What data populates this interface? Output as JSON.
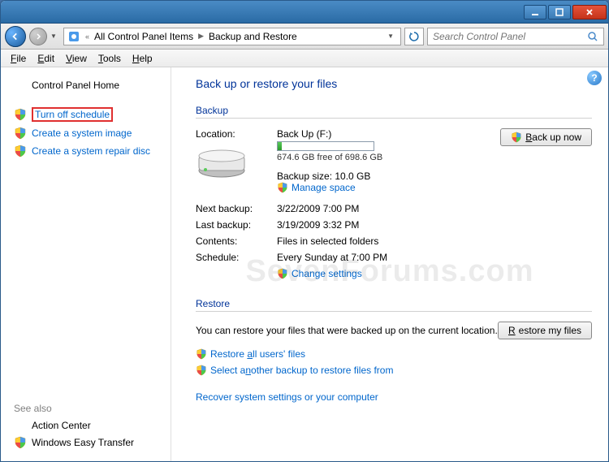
{
  "breadcrumb": {
    "prev": "All Control Panel Items",
    "current": "Backup and Restore"
  },
  "search": {
    "placeholder": "Search Control Panel"
  },
  "menu": {
    "file": "File",
    "edit": "Edit",
    "view": "View",
    "tools": "Tools",
    "help": "Help"
  },
  "sidebar": {
    "home": "Control Panel Home",
    "items": [
      "Turn off schedule",
      "Create a system image",
      "Create a system repair disc"
    ],
    "seealso_hdr": "See also",
    "seealso": [
      "Action Center",
      "Windows Easy Transfer"
    ]
  },
  "main": {
    "title": "Back up or restore your files",
    "backup_hdr": "Backup",
    "location_lbl": "Location:",
    "location_val": "Back Up (F:)",
    "freespace": "674.6 GB free of 698.6 GB",
    "backup_size_lbl": "Backup size: 10.0 GB",
    "manage_space": "Manage space",
    "backup_now": "Back up now",
    "rows": [
      {
        "lbl": "Next backup:",
        "val": "3/22/2009 7:00 PM"
      },
      {
        "lbl": "Last backup:",
        "val": "3/19/2009 3:32 PM"
      },
      {
        "lbl": "Contents:",
        "val": "Files in selected folders"
      },
      {
        "lbl": "Schedule:",
        "val": "Every Sunday at 7:00 PM"
      }
    ],
    "change_settings": "Change settings",
    "restore_hdr": "Restore",
    "restore_note": "You can restore your files that were backed up on the current location.",
    "restore_btn": "Restore my files",
    "restore_all": "Restore all users' files",
    "restore_select": "Select another backup to restore files from",
    "recover": "Recover system settings or your computer"
  },
  "watermark": "SevenForums.com"
}
